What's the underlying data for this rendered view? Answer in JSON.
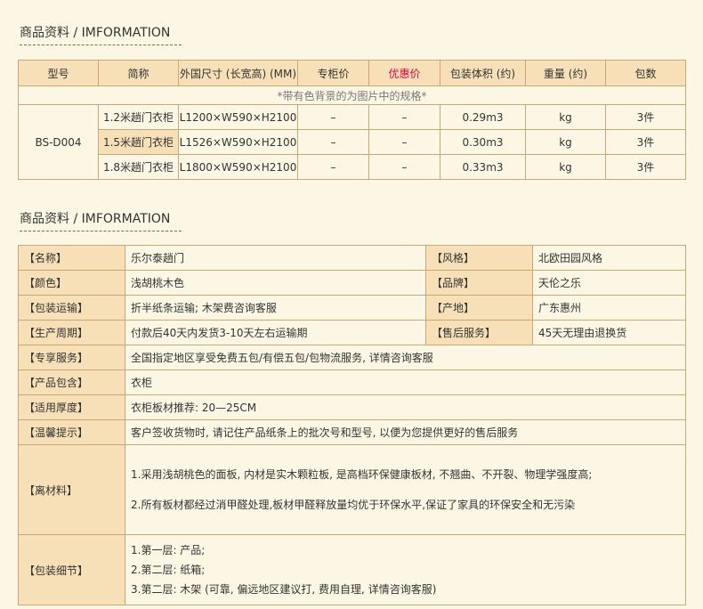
{
  "section1": {
    "title": "商品资料 / IMFORMATION"
  },
  "spec": {
    "headers": [
      "型号",
      "简称",
      "外国尺寸 (长宽高) (MM)",
      "专柜价",
      "优惠价",
      "包装体积 (约)",
      "重量 (约)",
      "包数"
    ],
    "note": "*带有色背景的为图片中的规格*",
    "model": "BS-D004",
    "rows": [
      {
        "name": "1.2米趟门衣柜",
        "size": "L1200×W590×H2100",
        "retail": "–",
        "promo": "–",
        "volume": "0.29m3",
        "weight": "kg",
        "packs": "3件"
      },
      {
        "name": "1.5米趟门衣柜",
        "size": "L1526×W590×H2100",
        "retail": "–",
        "promo": "–",
        "volume": "0.30m3",
        "weight": "kg",
        "packs": "3件"
      },
      {
        "name": "1.8米趟门衣柜",
        "size": "L1800×W590×H2100",
        "retail": "–",
        "promo": "–",
        "volume": "0.33m3",
        "weight": "kg",
        "packs": "3件"
      }
    ]
  },
  "section2": {
    "title": "商品资料 / IMFORMATION"
  },
  "info": {
    "name_label": "【名称】",
    "name_value": "乐尔泰趟门",
    "style_label": "【风格】",
    "style_value": "北欧田园风格",
    "color_label": "【颜色】",
    "color_value": "浅胡桃木色",
    "brand_label": "【品牌】",
    "brand_value": "天伦之乐",
    "shipping_label": "【包装运输】",
    "shipping_value": "折半纸条运输; 木架费咨询客服",
    "origin_label": "【产地】",
    "origin_value": "广东惠州",
    "cycle_label": "【生产周期】",
    "cycle_value": "付款后40天内发货3-10天左右运输期",
    "aftersale_label": "【售后服务】",
    "aftersale_value": "45天无理由退换货",
    "service_label": "【专享服务】",
    "service_value": "全国指定地区享受免费五包/有偿五包/包物流服务, 详情咨询客服",
    "contents_label": "【产品包含】",
    "contents_value": "衣柜",
    "thickness_label": "【适用厚度】",
    "thickness_value": "衣柜板材推荐: 20—25CM",
    "tip_label": "【温馨提示】",
    "tip_value": "客户签收货物时, 请记住产品纸条上的批次号和型号, 以便为您提供更好的售后服务",
    "material_label": "【离材料】",
    "material_lines": [
      "1.采用浅胡桃色的面板, 内材是实木颗粒板, 是高档环保健康板材, 不翘曲、不开裂、物理学强度高;",
      "2.所有板材都经过消甲醛处理,板材甲醛释放量均优于环保水平,保证了家具的环保安全和无污染"
    ],
    "packing_label": "【包装细节】",
    "packing_lines": [
      "1.第一层: 产品;",
      "2.第二层: 纸箱;",
      "3.第二层: 木架 (可靠, 偏远地区建议打, 费用自理, 详情咨询客服)"
    ]
  }
}
